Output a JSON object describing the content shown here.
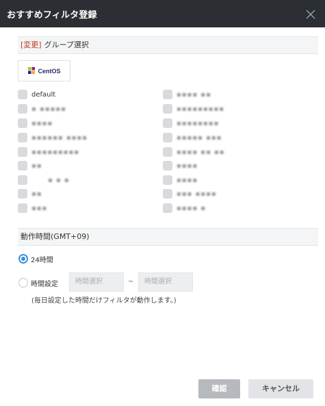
{
  "dialog": {
    "title": "おすすめフィルタ登録"
  },
  "group_section": {
    "change_link": "[変更]",
    "header": "グループ選択",
    "os_logo_text": "CentOS",
    "left_groups": [
      {
        "label": "default"
      },
      {
        "label": "▪ ▪▪▪▪▪"
      },
      {
        "label": "▪▪▪▪"
      },
      {
        "label": "▪▪▪▪▪▪ ▪▪▪▪"
      },
      {
        "label": "▪▪▪▪▪▪▪▪▪"
      },
      {
        "label": "▪▪"
      },
      {
        "label": "▪ ▪ ▪"
      },
      {
        "label": "▪▪"
      },
      {
        "label": "▪▪▪"
      }
    ],
    "right_groups": [
      {
        "label": "▪▪▪▪ ▪▪"
      },
      {
        "label": "▪▪▪▪▪▪▪▪▪"
      },
      {
        "label": "▪▪▪▪▪▪▪▪"
      },
      {
        "label": "▪▪▪▪▪ ▪▪▪"
      },
      {
        "label": "▪▪▪▪ ▪▪ ▪▪"
      },
      {
        "label": "▪▪▪▪"
      },
      {
        "label": "▪▪▪▪"
      },
      {
        "label": "▪▪▪ ▪▪▪▪"
      },
      {
        "label": "▪▪▪▪ ▪"
      }
    ]
  },
  "time_section": {
    "header": "動作時間(GMT+09)",
    "option_24h": "24時間",
    "option_custom": "時間設定",
    "start_placeholder": "時間選択",
    "end_placeholder": "時間選択",
    "separator": "~",
    "note": "(毎日設定した時間だけフィルタが動作します。)",
    "selected": "24時間"
  },
  "footer": {
    "confirm_label": "確認",
    "cancel_label": "キャンセル"
  },
  "colors": {
    "titlebar": "#2b2f33",
    "accent": "#3b8ddf",
    "change_link": "#c0392b"
  }
}
